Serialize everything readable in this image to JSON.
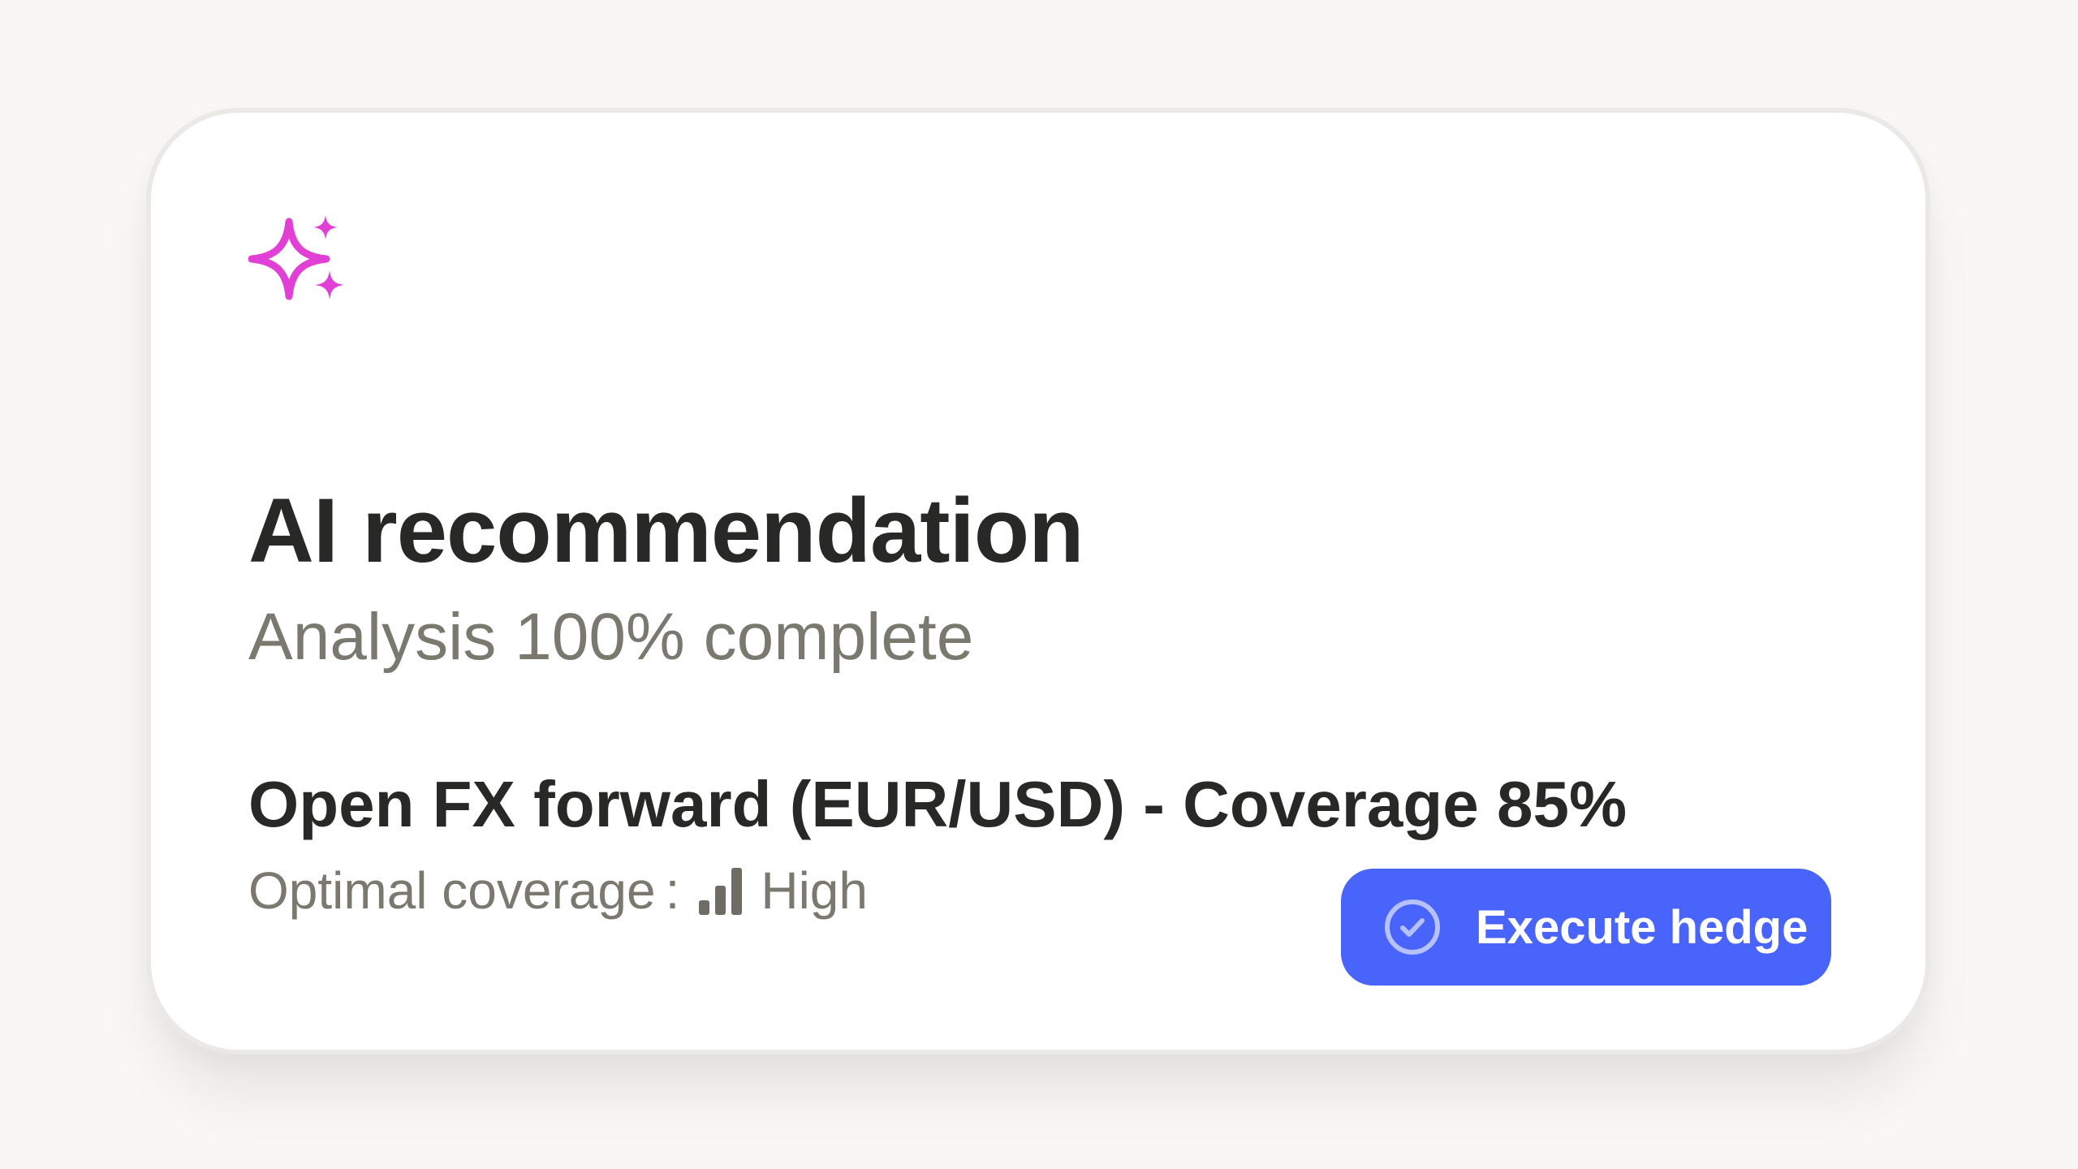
{
  "card": {
    "icon": "sparkles-icon",
    "title": "AI recommendation",
    "subtitle": "Analysis 100% complete",
    "recommendation": "Open FX forward (EUR/USD) - Coverage 85%",
    "coverage": {
      "label": "Optimal coverage",
      "separator": ":",
      "level": "High",
      "level_icon": "signal-bars-icon"
    },
    "action": {
      "label": "Execute hedge",
      "icon": "check-circle-icon"
    }
  },
  "colors": {
    "sparkle": "#e23fd6",
    "button": "#4964fb",
    "title": "#282826",
    "muted": "#7a786f",
    "background": "#f8f7f5"
  }
}
